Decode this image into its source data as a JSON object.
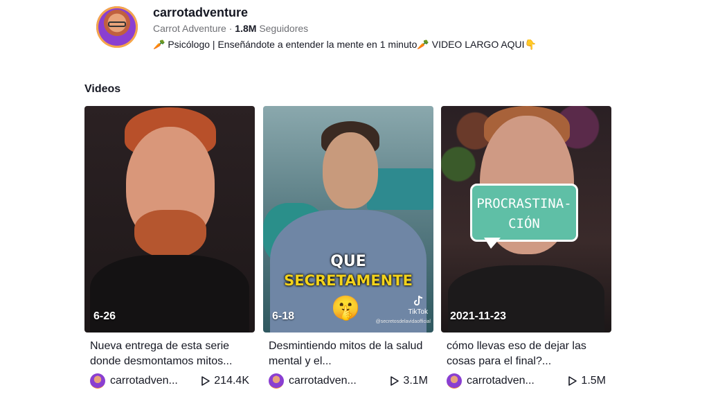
{
  "profile": {
    "username": "carrotadventure",
    "display_name": "Carrot Adventure",
    "separator": " · ",
    "followers_count": "1.8M",
    "followers_label": "Seguidores",
    "bio": "🥕 Psicólogo | Enseñándote a entender la mente en 1 minuto🥕  VIDEO LARGO AQUI👇"
  },
  "section_title": "Videos",
  "videos": [
    {
      "date": "6-26",
      "description": "Nueva entrega de esta serie donde desmontamos mitos...",
      "author": "carrotadven...",
      "views": "214.4K"
    },
    {
      "date": "6-18",
      "description": "Desmintiendo mitos de la salud mental y el...",
      "author": "carrotadven...",
      "views": "3.1M",
      "overlay_line1": "QUE",
      "overlay_line2": "SECRETAMENTE",
      "overlay_emoji": "🤫",
      "overlay_logo": "TikTok",
      "overlay_watermark": "@secretosdelavidaofficial"
    },
    {
      "date": "2021-11-23",
      "description": "cómo llevas eso de dejar las cosas para el final?...",
      "author": "carrotadven...",
      "views": "1.5M",
      "overlay_line1": "PROCRASTINA-",
      "overlay_line2": "CIÓN"
    }
  ],
  "icons": {
    "views": "play-icon",
    "avatar": "profile-avatar"
  }
}
